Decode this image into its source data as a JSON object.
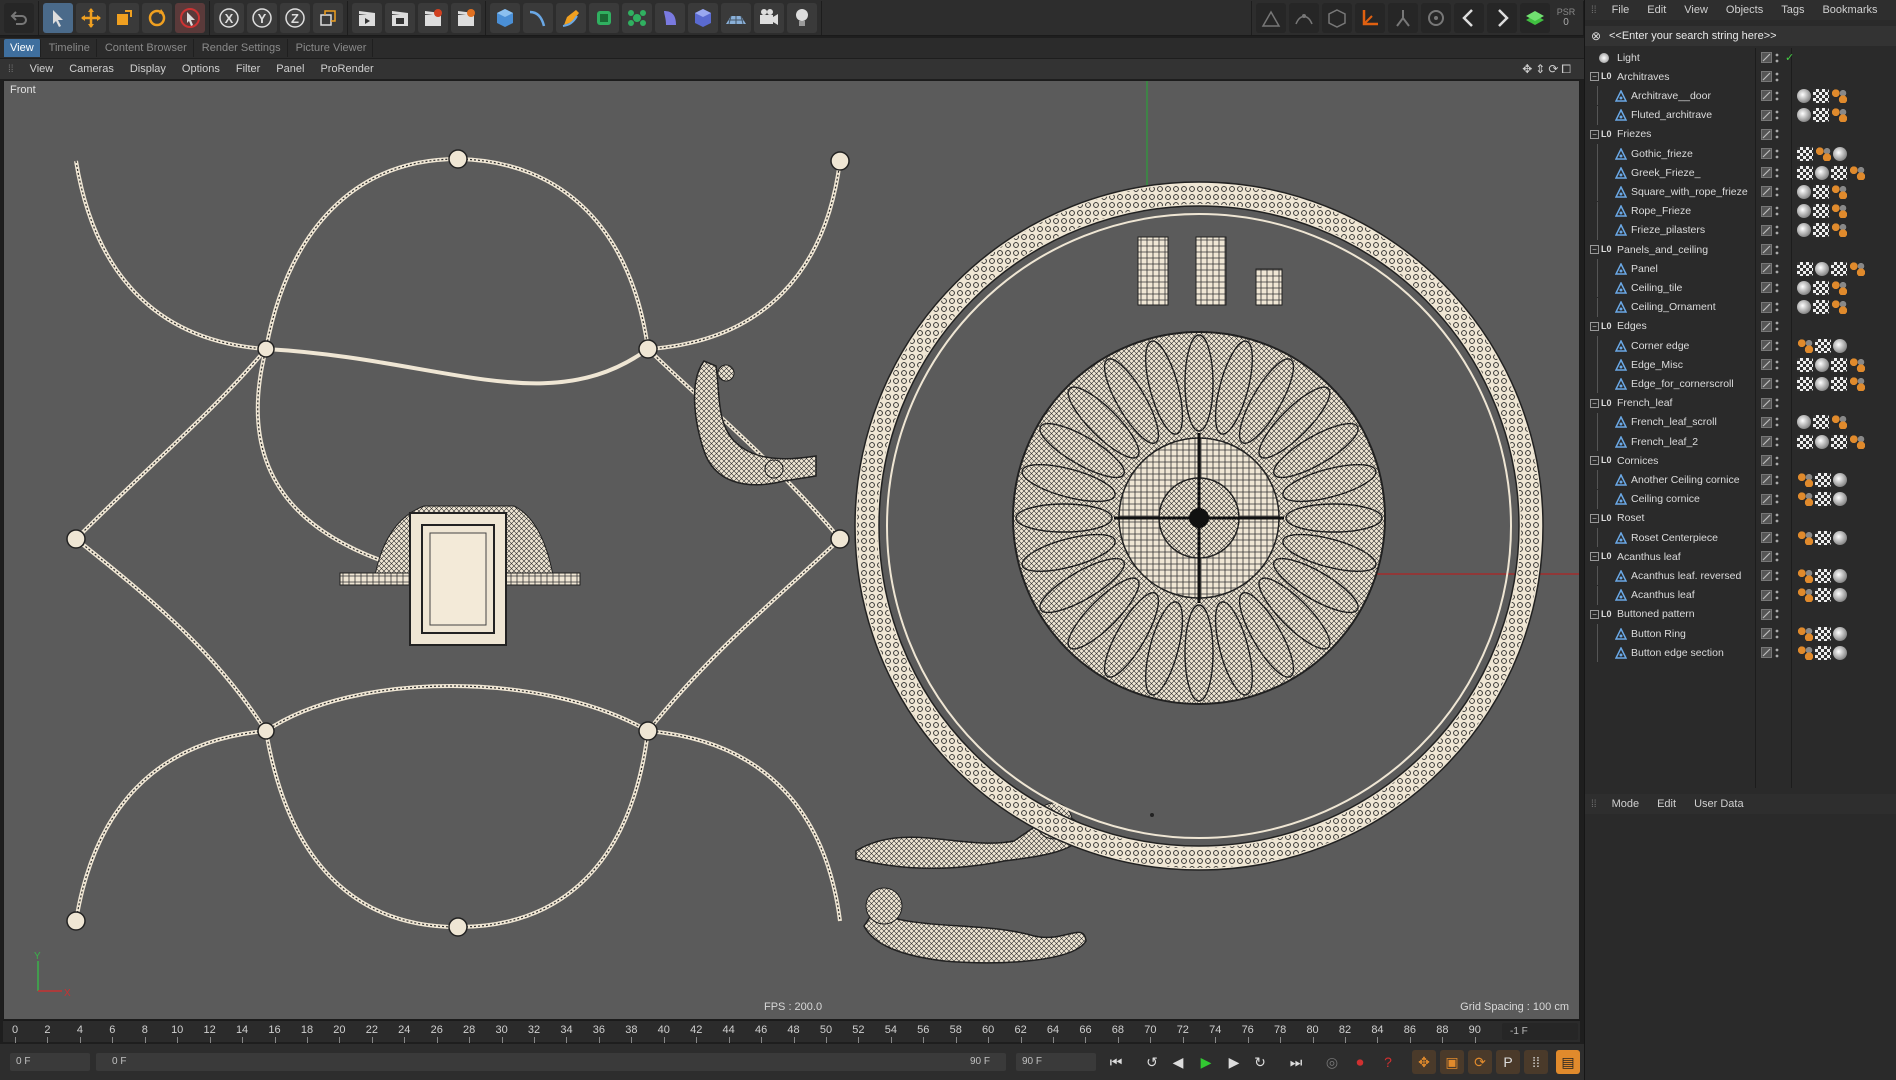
{
  "toolbar": {
    "icons": [
      "undo-icon",
      "select-arrow-icon",
      "move-icon",
      "scale-icon",
      "rotate-icon",
      "live-select-icon",
      "x-axis-icon",
      "y-axis-icon",
      "z-axis-icon",
      "world-coords-icon",
      "render-view-icon",
      "render-picture-viewer-icon",
      "render-settings-icon",
      "render-active-icon",
      "cube-icon",
      "spline-icon",
      "pen-icon",
      "subdivision-icon",
      "cloner-icon",
      "deformer-icon",
      "scene-icon",
      "floor-icon",
      "camera-icon",
      "light-icon"
    ],
    "right_icons": [
      "model-mode-icon",
      "points-mode-icon",
      "polygons-mode-icon",
      "axis-mode-icon",
      "bones-icon",
      "snap-icon",
      "prev-icon",
      "next-icon",
      "layout-icon"
    ],
    "psr_label": "PSR",
    "psr_value": "0"
  },
  "tabs": [
    "View",
    "Timeline",
    "Content Browser",
    "Render Settings",
    "Picture Viewer"
  ],
  "view_menu": [
    "View",
    "Cameras",
    "Display",
    "Options",
    "Filter",
    "Panel",
    "ProRender"
  ],
  "viewport": {
    "label": "Front",
    "fps": "FPS : 200.0",
    "grid_spacing": "Grid Spacing : 100 cm",
    "axis_x": "X",
    "axis_y": "Y"
  },
  "timeline": {
    "ticks": [
      "0",
      "2",
      "4",
      "6",
      "8",
      "10",
      "12",
      "14",
      "16",
      "18",
      "20",
      "22",
      "24",
      "26",
      "28",
      "30",
      "32",
      "34",
      "36",
      "38",
      "40",
      "42",
      "44",
      "46",
      "48",
      "50",
      "52",
      "54",
      "56",
      "58",
      "60",
      "62",
      "64",
      "66",
      "68",
      "70",
      "72",
      "74",
      "76",
      "78",
      "80",
      "82",
      "84",
      "86",
      "88",
      "90"
    ],
    "frame_end": "-1 F",
    "current_frame": "0 F",
    "range_start": "0 F",
    "range_end": "90 F",
    "max_frame": "90 F"
  },
  "object_manager": {
    "menu": [
      "File",
      "Edit",
      "View",
      "Objects",
      "Tags",
      "Bookmarks"
    ],
    "search_placeholder": "<<Enter your search string here>>",
    "rows": [
      {
        "name": "Light",
        "level": 0,
        "type": "light",
        "tags": []
      },
      {
        "name": "Architraves",
        "level": 0,
        "type": "null",
        "tags": []
      },
      {
        "name": "Architrave__door",
        "level": 1,
        "type": "mesh",
        "tags": [
          "sph",
          "chk",
          "org"
        ]
      },
      {
        "name": "Fluted_architrave",
        "level": 1,
        "type": "mesh",
        "tags": [
          "sph",
          "chk",
          "org"
        ]
      },
      {
        "name": "Friezes",
        "level": 0,
        "type": "null",
        "tags": []
      },
      {
        "name": "Gothic_frieze",
        "level": 1,
        "type": "mesh",
        "tags": [
          "chk",
          "org",
          "sph"
        ]
      },
      {
        "name": "Greek_Frieze_",
        "level": 1,
        "type": "mesh",
        "tags": [
          "chk",
          "sph",
          "chk",
          "org"
        ]
      },
      {
        "name": "Square_with_rope_frieze",
        "level": 1,
        "type": "mesh",
        "tags": [
          "sph",
          "chk",
          "org"
        ]
      },
      {
        "name": "Rope_Frieze",
        "level": 1,
        "type": "mesh",
        "tags": [
          "sph",
          "chk",
          "org"
        ]
      },
      {
        "name": "Frieze_pilasters",
        "level": 1,
        "type": "mesh",
        "tags": [
          "sph",
          "chk",
          "org"
        ]
      },
      {
        "name": "Panels_and_ceiling",
        "level": 0,
        "type": "null",
        "tags": []
      },
      {
        "name": "Panel",
        "level": 1,
        "type": "mesh",
        "tags": [
          "chk",
          "sph",
          "chk",
          "org"
        ]
      },
      {
        "name": "Ceiling_tile",
        "level": 1,
        "type": "mesh",
        "tags": [
          "sph",
          "chk",
          "org"
        ]
      },
      {
        "name": "Ceiling_Ornament",
        "level": 1,
        "type": "mesh",
        "tags": [
          "sph",
          "chk",
          "org"
        ]
      },
      {
        "name": "Edges",
        "level": 0,
        "type": "null",
        "tags": []
      },
      {
        "name": "Corner edge",
        "level": 1,
        "type": "mesh",
        "tags": [
          "org",
          "chk",
          "sph"
        ]
      },
      {
        "name": "Edge_Misc",
        "level": 1,
        "type": "mesh",
        "tags": [
          "chk",
          "sph",
          "chk",
          "org"
        ]
      },
      {
        "name": "Edge_for_cornerscroll",
        "level": 1,
        "type": "mesh",
        "tags": [
          "chk",
          "sph",
          "chk",
          "org"
        ]
      },
      {
        "name": "French_leaf",
        "level": 0,
        "type": "null",
        "tags": []
      },
      {
        "name": "French_leaf_scroll",
        "level": 1,
        "type": "mesh",
        "tags": [
          "sph",
          "chk",
          "org"
        ]
      },
      {
        "name": "French_leaf_2",
        "level": 1,
        "type": "mesh",
        "tags": [
          "chk",
          "sph",
          "chk",
          "org"
        ]
      },
      {
        "name": "Cornices",
        "level": 0,
        "type": "null",
        "tags": []
      },
      {
        "name": "Another Ceiling cornice",
        "level": 1,
        "type": "mesh",
        "tags": [
          "org",
          "chk",
          "sph"
        ]
      },
      {
        "name": "Ceiling cornice",
        "level": 1,
        "type": "mesh",
        "tags": [
          "org",
          "chk",
          "sph"
        ]
      },
      {
        "name": "Roset",
        "level": 0,
        "type": "null",
        "tags": []
      },
      {
        "name": "Roset Centerpiece",
        "level": 1,
        "type": "mesh",
        "tags": [
          "org",
          "chk",
          "sph"
        ]
      },
      {
        "name": "Acanthus leaf",
        "level": 0,
        "type": "null",
        "tags": []
      },
      {
        "name": "Acanthus leaf. reversed",
        "level": 1,
        "type": "mesh",
        "tags": [
          "org",
          "chk",
          "sph"
        ]
      },
      {
        "name": "Acanthus leaf",
        "level": 1,
        "type": "mesh",
        "tags": [
          "org",
          "chk",
          "sph"
        ]
      },
      {
        "name": "Buttoned pattern",
        "level": 0,
        "type": "null",
        "tags": []
      },
      {
        "name": "Button Ring",
        "level": 1,
        "type": "mesh",
        "tags": [
          "org",
          "chk",
          "sph"
        ]
      },
      {
        "name": "Button edge section",
        "level": 1,
        "type": "mesh",
        "tags": [
          "org",
          "chk",
          "sph"
        ]
      }
    ]
  },
  "attributes": {
    "menu": [
      "Mode",
      "Edit",
      "User Data"
    ]
  },
  "colors": {
    "accent": "#3f6f9e",
    "viewport_bg": "#5b5b5b",
    "wire": "#efe6d4",
    "play_green": "#32c832",
    "record_red": "#d03030",
    "key_orange": "#e08a2c"
  }
}
